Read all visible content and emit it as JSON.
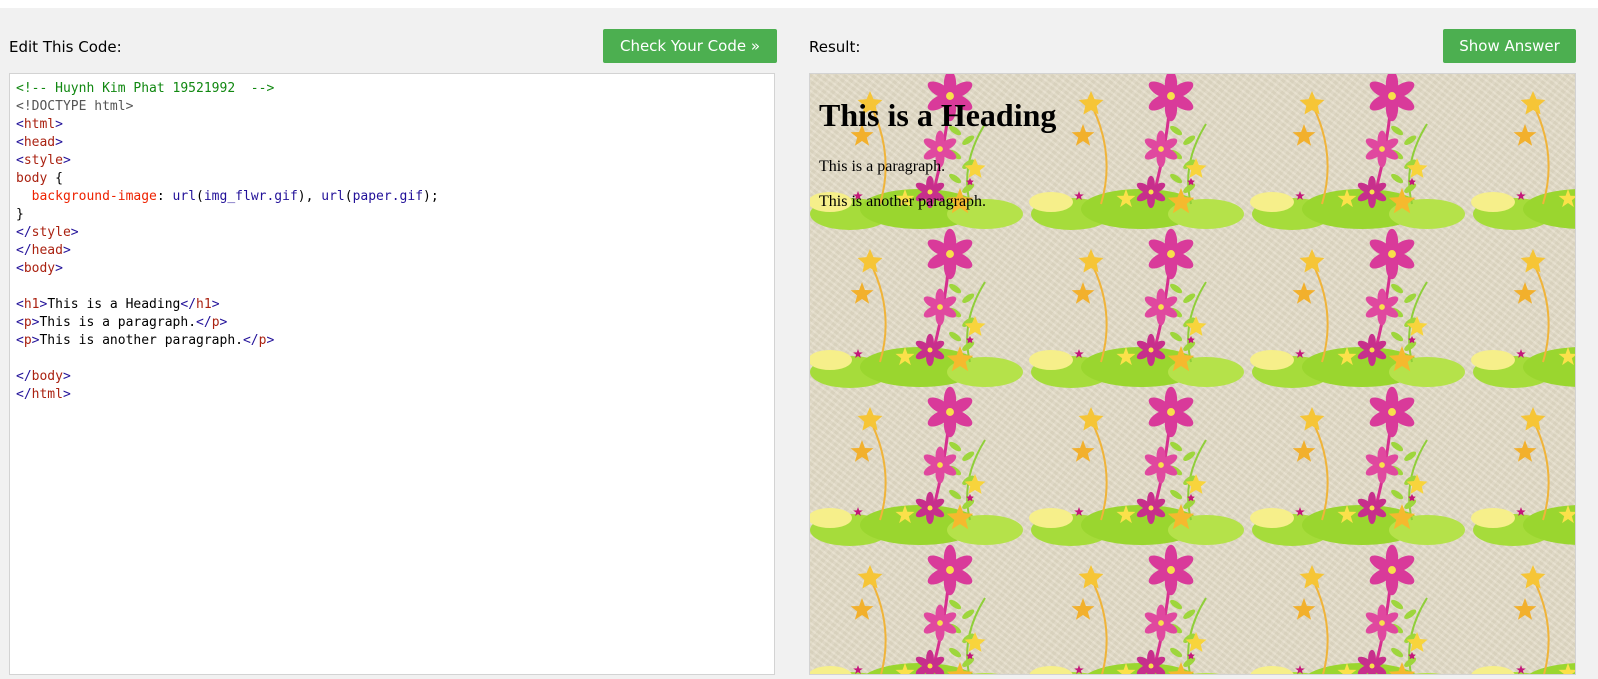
{
  "left_panel": {
    "label": "Edit This Code:",
    "button": "Check Your Code »",
    "code_lines": [
      [
        {
          "t": "<!-- Huynh Kim Phat 19521992  -->",
          "c": "comment"
        }
      ],
      [
        {
          "t": "<!DOCTYPE html>",
          "c": "doctype"
        }
      ],
      [
        {
          "t": "<",
          "c": "bracket"
        },
        {
          "t": "html",
          "c": "tag"
        },
        {
          "t": ">",
          "c": "bracket"
        }
      ],
      [
        {
          "t": "<",
          "c": "bracket"
        },
        {
          "t": "head",
          "c": "tag"
        },
        {
          "t": ">",
          "c": "bracket"
        }
      ],
      [
        {
          "t": "<",
          "c": "bracket"
        },
        {
          "t": "style",
          "c": "tag"
        },
        {
          "t": ">",
          "c": "bracket"
        }
      ],
      [
        {
          "t": "body",
          "c": "sel"
        },
        {
          "t": " {",
          "c": "punct"
        }
      ],
      [
        {
          "t": "  ",
          "c": "punct"
        },
        {
          "t": "background-image",
          "c": "prop"
        },
        {
          "t": ": ",
          "c": "punct"
        },
        {
          "t": "url",
          "c": "func"
        },
        {
          "t": "(",
          "c": "punct"
        },
        {
          "t": "img_flwr.gif",
          "c": "func"
        },
        {
          "t": "), ",
          "c": "punct"
        },
        {
          "t": "url",
          "c": "func"
        },
        {
          "t": "(",
          "c": "punct"
        },
        {
          "t": "paper.gif",
          "c": "func"
        },
        {
          "t": ");",
          "c": "punct"
        }
      ],
      [
        {
          "t": "}",
          "c": "punct"
        }
      ],
      [
        {
          "t": "</",
          "c": "bracket"
        },
        {
          "t": "style",
          "c": "tag"
        },
        {
          "t": ">",
          "c": "bracket"
        }
      ],
      [
        {
          "t": "</",
          "c": "bracket"
        },
        {
          "t": "head",
          "c": "tag"
        },
        {
          "t": ">",
          "c": "bracket"
        }
      ],
      [
        {
          "t": "<",
          "c": "bracket"
        },
        {
          "t": "body",
          "c": "tag"
        },
        {
          "t": ">",
          "c": "bracket"
        }
      ],
      [],
      [
        {
          "t": "<",
          "c": "bracket"
        },
        {
          "t": "h1",
          "c": "tag"
        },
        {
          "t": ">",
          "c": "bracket"
        },
        {
          "t": "This is a Heading",
          "c": "punct"
        },
        {
          "t": "</",
          "c": "bracket"
        },
        {
          "t": "h1",
          "c": "tag"
        },
        {
          "t": ">",
          "c": "bracket"
        }
      ],
      [
        {
          "t": "<",
          "c": "bracket"
        },
        {
          "t": "p",
          "c": "tag"
        },
        {
          "t": ">",
          "c": "bracket"
        },
        {
          "t": "This is a paragraph.",
          "c": "punct"
        },
        {
          "t": "</",
          "c": "bracket"
        },
        {
          "t": "p",
          "c": "tag"
        },
        {
          "t": ">",
          "c": "bracket"
        }
      ],
      [
        {
          "t": "<",
          "c": "bracket"
        },
        {
          "t": "p",
          "c": "tag"
        },
        {
          "t": ">",
          "c": "bracket"
        },
        {
          "t": "This is another paragraph.",
          "c": "punct"
        },
        {
          "t": "</",
          "c": "bracket"
        },
        {
          "t": "p",
          "c": "tag"
        },
        {
          "t": ">",
          "c": "bracket"
        }
      ],
      [],
      [
        {
          "t": "</",
          "c": "bracket"
        },
        {
          "t": "body",
          "c": "tag"
        },
        {
          "t": ">",
          "c": "bracket"
        }
      ],
      [
        {
          "t": "</",
          "c": "bracket"
        },
        {
          "t": "html",
          "c": "tag"
        },
        {
          "t": ">",
          "c": "bracket"
        }
      ]
    ]
  },
  "right_panel": {
    "label": "Result:",
    "button": "Show Answer",
    "heading": "This is a Heading",
    "paragraphs": [
      "This is a paragraph.",
      "This is another paragraph."
    ],
    "background_images": [
      "flower-tile-image",
      "paper-texture-image"
    ]
  },
  "colors": {
    "button": "#4caf50",
    "page_bg": "#f1f1f1",
    "comment": "#118811",
    "tag": "#aa2211",
    "bracket": "#221199"
  }
}
